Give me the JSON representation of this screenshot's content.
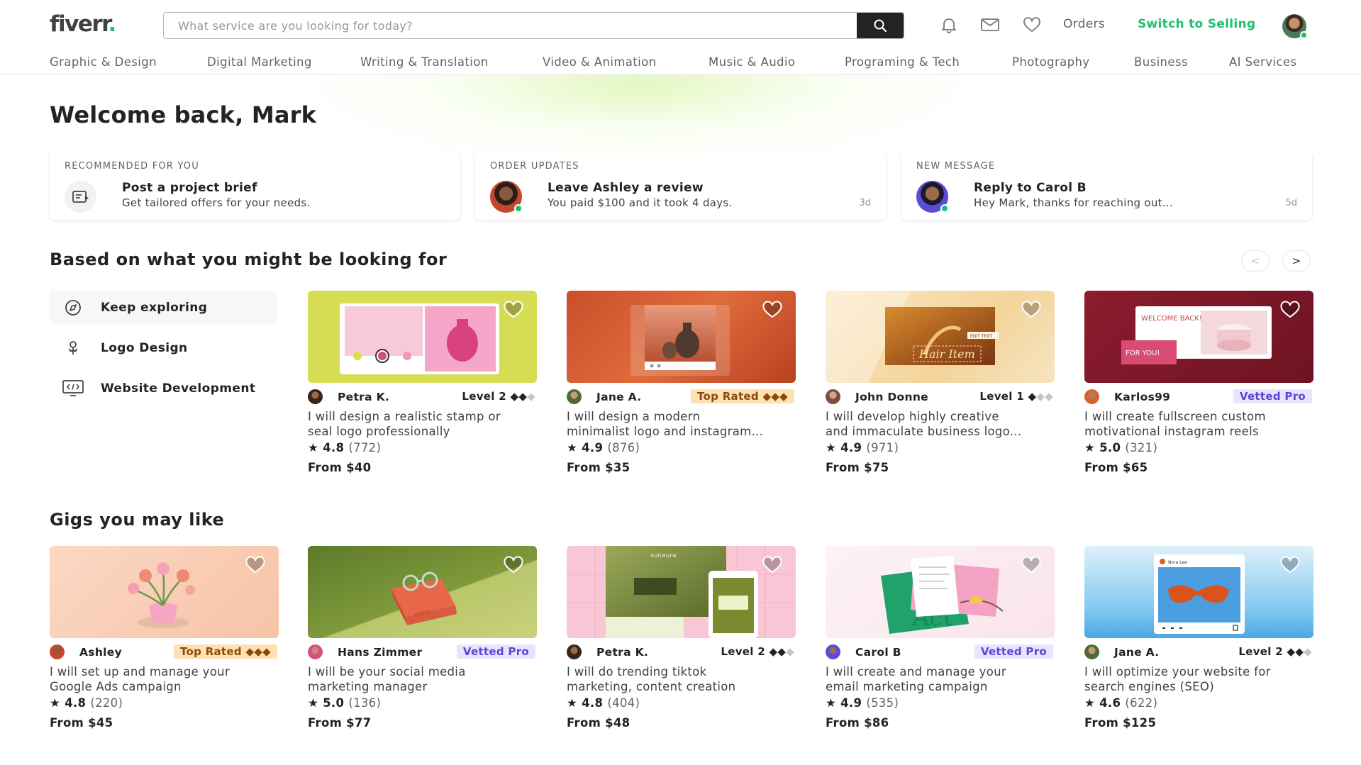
{
  "header": {
    "logo_text": "fiverr",
    "logo_dot": ".",
    "search_placeholder": "What service are you looking for today?",
    "orders_label": "Orders",
    "switch_label": "Switch to Selling",
    "brand_color": "#1dbf73"
  },
  "categories": [
    "Graphic & Design",
    "Digital Marketing",
    "Writing & Translation",
    "Video & Animation",
    "Music & Audio",
    "Programing & Tech",
    "Photography",
    "Business",
    "AI Services"
  ],
  "welcome": "Welcome back, Mark",
  "notifications": [
    {
      "kicker": "RECOMMENDED FOR YOU",
      "title": "Post a project brief",
      "subtitle": "Get tailored offers for your needs.",
      "time": "",
      "icon": "brief-icon"
    },
    {
      "kicker": "ORDER UPDATES",
      "title": "Leave Ashley a review",
      "subtitle": "You paid $100 and it took 4 days.",
      "time": "3d",
      "icon": "avatar"
    },
    {
      "kicker": "NEW MESSAGE",
      "title": "Reply to Carol B",
      "subtitle": "Hey Mark, thanks for reaching out...",
      "time": "5d",
      "icon": "avatar"
    }
  ],
  "section1": {
    "title": "Based on what you might be looking for",
    "prev_arrow": "<",
    "next_arrow": ">",
    "explore": [
      {
        "label": "Keep exploring",
        "icon": "compass-icon"
      },
      {
        "label": "Logo Design",
        "icon": "pen-tool-icon"
      },
      {
        "label": "Website Development",
        "icon": "code-monitor-icon"
      }
    ],
    "gigs": [
      {
        "seller": "Petra K.",
        "badge_type": "level",
        "badge": "Level 2",
        "diamonds": "◆◆",
        "diamonds_dim": "◆",
        "title_line1": "I will design a realistic stamp or",
        "title_line2": "seal logo professionally",
        "rating": "4.8",
        "count": "(772)",
        "price": "From $40"
      },
      {
        "seller": "Jane A.",
        "badge_type": "top",
        "badge": "Top Rated",
        "diamonds": "◆◆◆",
        "diamonds_dim": "",
        "title_line1": "I will design a modern",
        "title_line2": "minimalist logo and instagram...",
        "rating": "4.9",
        "count": "(876)",
        "price": "From $35"
      },
      {
        "seller": "John Donne",
        "badge_type": "level",
        "badge": "Level 1",
        "diamonds": "◆",
        "diamonds_dim": "◆◆",
        "title_line1": "I will develop highly creative",
        "title_line2": "and immaculate business logo...",
        "rating": "4.9",
        "count": "(971)",
        "price": "From $75"
      },
      {
        "seller": "Karlos99",
        "badge_type": "pro",
        "badge": "Vetted Pro",
        "diamonds": "",
        "diamonds_dim": "",
        "title_line1": "I will create fullscreen custom",
        "title_line2": "motivational instagram reels",
        "rating": "5.0",
        "count": "(321)",
        "price": "From $65"
      }
    ]
  },
  "section2": {
    "title": "Gigs you may like",
    "gigs": [
      {
        "seller": "Ashley",
        "badge_type": "top",
        "badge": "Top Rated",
        "diamonds": "◆◆◆",
        "diamonds_dim": "",
        "title_line1": "I will set up and manage your",
        "title_line2": "Google Ads campaign",
        "rating": "4.8",
        "count": "(220)",
        "price": "From $45"
      },
      {
        "seller": "Hans Zimmer",
        "badge_type": "pro",
        "badge": "Vetted Pro",
        "diamonds": "",
        "diamonds_dim": "",
        "title_line1": "I will be your social media",
        "title_line2": "marketing manager",
        "rating": "5.0",
        "count": "(136)",
        "price": "From $77"
      },
      {
        "seller": "Petra K.",
        "badge_type": "level",
        "badge": "Level 2",
        "diamonds": "◆◆",
        "diamonds_dim": "◆",
        "title_line1": "I will do trending tiktok",
        "title_line2": "marketing, content creation",
        "rating": "4.8",
        "count": "(404)",
        "price": "From $48"
      },
      {
        "seller": "Carol B",
        "badge_type": "pro",
        "badge": "Vetted Pro",
        "diamonds": "",
        "diamonds_dim": "",
        "title_line1": "I will create and manage your",
        "title_line2": "email marketing campaign",
        "rating": "4.9",
        "count": "(535)",
        "price": "From $86"
      },
      {
        "seller": "Jane A.",
        "badge_type": "level",
        "badge": "Level 2",
        "diamonds": "◆◆",
        "diamonds_dim": "◆",
        "title_line1": "I will optimize your website for",
        "title_line2": "search engines (SEO)",
        "rating": "4.6",
        "count": "(622)",
        "price": "From $125"
      }
    ]
  },
  "thumb_text": {
    "welcome_back": "WELCOME BACK!",
    "for_you": "FOR YOU!",
    "edit_text": "EDIT TEXT",
    "script_sample": "Hair Item",
    "sunaura": "sunaura",
    "nora_lee": "Nora Lee",
    "stamp": "ennit",
    "envelope_letters": "Act"
  }
}
